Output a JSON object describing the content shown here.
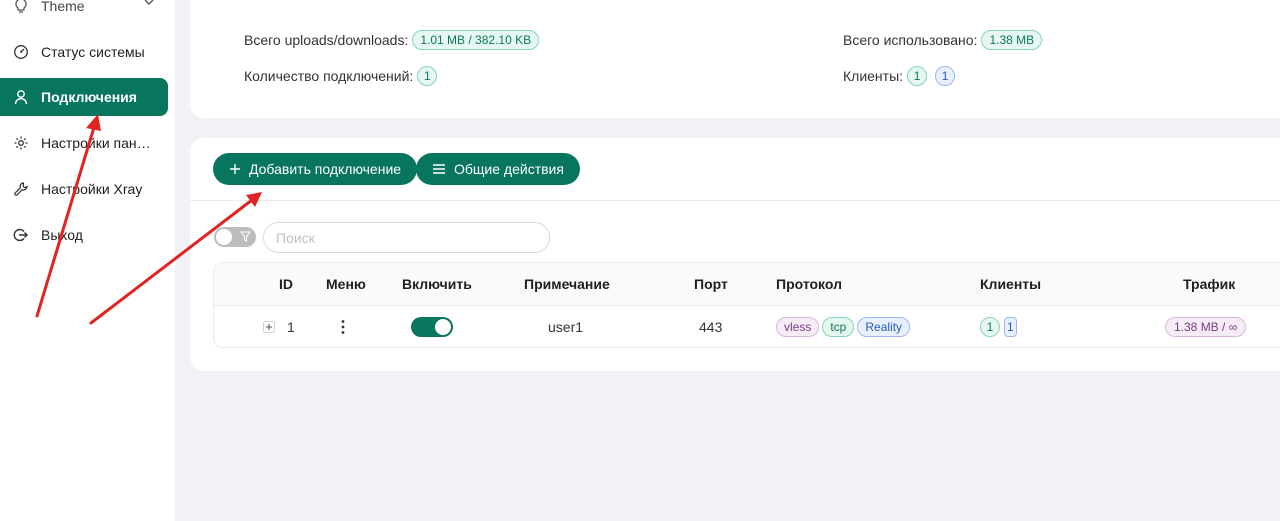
{
  "sidebar": {
    "theme_label": "Theme",
    "items": [
      {
        "label": "Статус системы",
        "icon": "dashboard-icon"
      },
      {
        "label": "Подключения",
        "icon": "user-icon",
        "active": true
      },
      {
        "label": "Настройки панели",
        "icon": "gear-icon"
      },
      {
        "label": "Настройки Xray",
        "icon": "wrench-icon"
      },
      {
        "label": "Выход",
        "icon": "logout-icon"
      }
    ]
  },
  "stats": {
    "traffic_label": "Всего uploads/downloads:",
    "traffic_value": "1.01 MB / 382.10 KB",
    "used_label": "Всего использовано:",
    "used_value": "1.38 MB",
    "connections_label": "Количество подключений:",
    "connections_value": "1",
    "clients_label": "Клиенты:",
    "clients_value_1": "1",
    "clients_value_2": "1"
  },
  "toolbar": {
    "add_label": "Добавить подключение",
    "general_label": "Общие действия"
  },
  "search": {
    "placeholder": "Поиск"
  },
  "table": {
    "headers": {
      "id": "ID",
      "menu": "Меню",
      "enable": "Включить",
      "remark": "Примечание",
      "port": "Порт",
      "protocol": "Протокол",
      "clients": "Клиенты",
      "traffic": "Трафик"
    },
    "rows": [
      {
        "id": "1",
        "enabled": true,
        "remark": "user1",
        "port": "443",
        "protocol_tags": [
          "vless",
          "tcp",
          "Reality"
        ],
        "clients_1": "1",
        "clients_2": "1",
        "traffic": "1.38 MB / ∞"
      }
    ]
  },
  "colors": {
    "accent": "#08765f",
    "annotation_arrow": "#e02424"
  }
}
